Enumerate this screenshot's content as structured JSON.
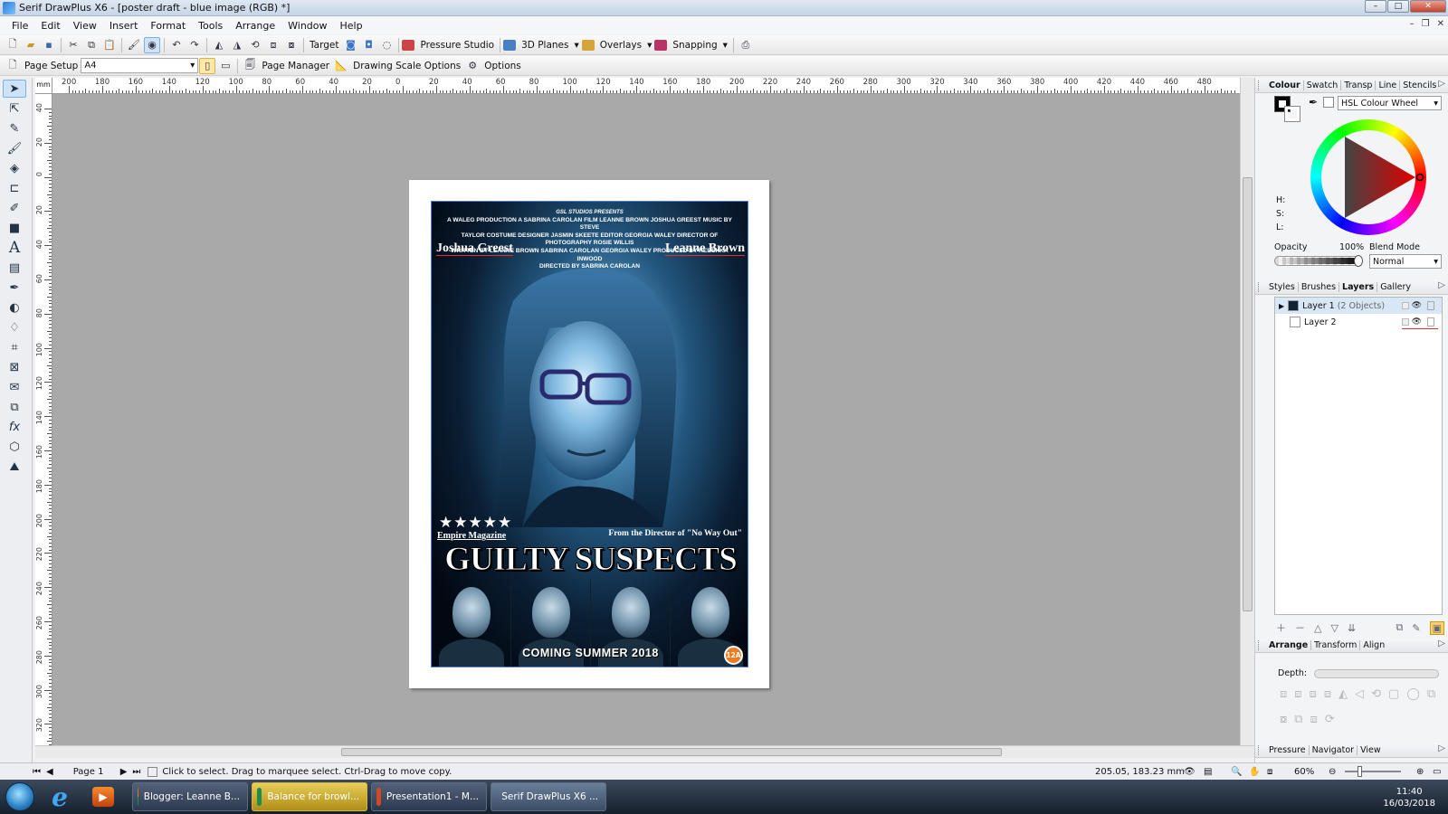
{
  "window": {
    "title": "Serif DrawPlus X6 - [poster draft - blue image (RGB) *]"
  },
  "menu": [
    "File",
    "Edit",
    "View",
    "Insert",
    "Format",
    "Tools",
    "Arrange",
    "Window",
    "Help"
  ],
  "toolbar1": {
    "target": "Target",
    "pressure_studio": "Pressure Studio",
    "planes_3d": "3D Planes",
    "overlays": "Overlays",
    "snapping": "Snapping"
  },
  "toolbar2": {
    "page_setup": "Page Setup",
    "page_size": "A4",
    "page_manager": "Page Manager",
    "drawing_scale": "Drawing Scale Options",
    "options": "Options"
  },
  "ruler": {
    "unit": "mm",
    "h_ticks": [
      "200",
      "180",
      "160",
      "140",
      "120",
      "100",
      "80",
      "60",
      "40",
      "20",
      "0",
      "20",
      "40",
      "60",
      "80",
      "100",
      "120",
      "140",
      "160",
      "180",
      "200",
      "220",
      "240",
      "260",
      "280",
      "300",
      "320",
      "340",
      "360",
      "380",
      "400",
      "420",
      "440",
      "460",
      "480"
    ],
    "v_ticks": [
      "40",
      "20",
      "0",
      "20",
      "40",
      "60",
      "80",
      "100",
      "120",
      "140",
      "160",
      "180",
      "200",
      "220",
      "240",
      "260",
      "280",
      "300",
      "320"
    ]
  },
  "poster": {
    "credits": {
      "studio": "GSL STUDIOS PRESENTS",
      "line1": "A WALEG PRODUCTION A SABRINA CAROLAN FILM LEANNE BROWN JOSHUA GREEST MUSIC BY STEVE",
      "line2": "TAYLOR COSTUME DESIGNER JASMIN SKEETE EDITOR GEORGIA WALEY DIRECTOR OF PHOTOGRAPHY ROSIE WILLIS",
      "line3": "WRITTEN BY LEANNE BROWN SABRINA CAROLAN GEORGIA WALEY PRODUCED BY REBEKKA INWOOD",
      "line4": "DIRECTED BY SABRINA CAROLAN"
    },
    "actor_left": "Joshua Greest",
    "actor_right": "Leanne Brown",
    "stars": "★★★★★",
    "review_source": "Empire Magazine",
    "tagline": "From the Director of \"No Way Out\"",
    "film_title": "GUILTY SUSPECTS",
    "release": "COMING SUMMER 2018",
    "rating": "12A"
  },
  "right_panel": {
    "colour_tabs": [
      "Colour",
      "Swatch",
      "Transp",
      "Line",
      "Stencils"
    ],
    "colour_mode": "HSL Colour Wheel",
    "hsl_labels": [
      "H:",
      "S:",
      "L:"
    ],
    "opacity_label": "Opacity",
    "opacity_value": "100%",
    "blend_mode_label": "Blend Mode",
    "blend_mode_value": "Normal",
    "layer_tabs": [
      "Styles",
      "Brushes",
      "Layers",
      "Gallery"
    ],
    "layers": [
      {
        "name": "Layer 1",
        "detail": "(2 Objects)"
      },
      {
        "name": "Layer 2",
        "detail": ""
      }
    ],
    "arrange_tabs": [
      "Arrange",
      "Transform",
      "Align"
    ],
    "depth_label": "Depth:",
    "bottom_tabs": [
      "Pressure",
      "Navigator",
      "View"
    ]
  },
  "status": {
    "page": "Page 1",
    "hint": "Click to select. Drag to marquee select. Ctrl-Drag to move copy.",
    "coords": "205.05, 183.23 mm",
    "zoom": "60%"
  },
  "taskbar": {
    "tasks": [
      {
        "label": "Blogger: Leanne B..."
      },
      {
        "label": "Balance for browl..."
      },
      {
        "label": "Presentation1 - M..."
      },
      {
        "label": "Serif DrawPlus X6 ..."
      }
    ],
    "time": "11:40",
    "date": "16/03/2018"
  },
  "colors": {
    "accent": "#4f7fd2",
    "rating_orange": "#f07b1f",
    "workspace": "#a9a9a9"
  }
}
